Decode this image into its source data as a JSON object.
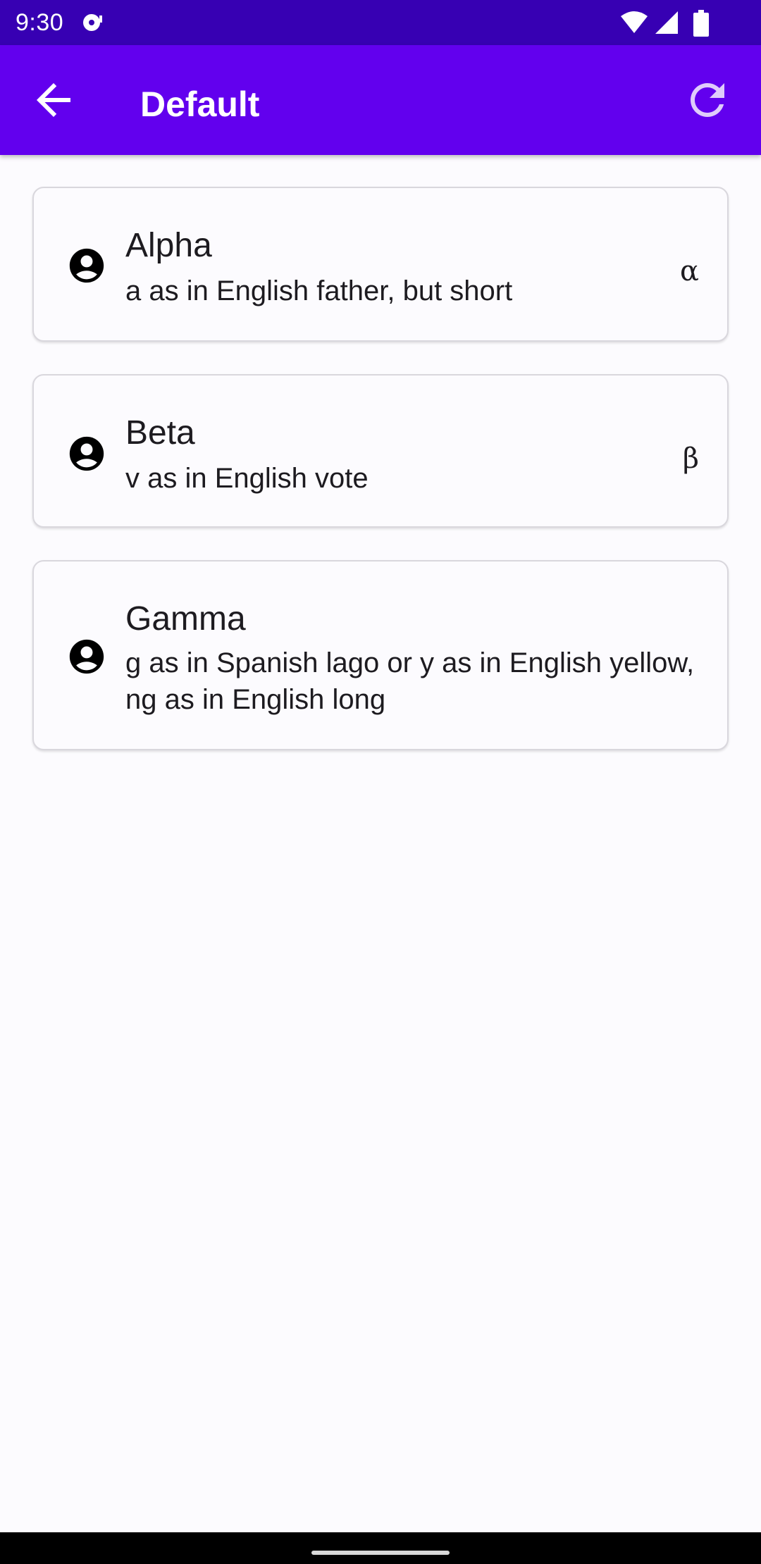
{
  "status_bar": {
    "time": "9:30",
    "icons": [
      "notification-icon",
      "wifi-icon",
      "signal-icon",
      "battery-icon"
    ]
  },
  "app_bar": {
    "title": "Default",
    "back_icon": "arrow-back-icon",
    "refresh_icon": "refresh-icon"
  },
  "items": [
    {
      "title": "Alpha",
      "subtitle": "a as in English father, but short",
      "symbol": "α",
      "icon": "account-circle-icon"
    },
    {
      "title": "Beta",
      "subtitle": "v as in English vote",
      "symbol": "β",
      "icon": "account-circle-icon"
    },
    {
      "title": "Gamma",
      "subtitle": "g as in Spanish lago or y as in English yellow, ng as in English long",
      "symbol": "",
      "icon": "account-circle-icon"
    }
  ],
  "colors": {
    "status_bar": "#3700b3",
    "app_bar": "#6200ee",
    "background": "#fcfbfe",
    "card_border": "#d9d7dd",
    "text": "#1d1b20"
  }
}
